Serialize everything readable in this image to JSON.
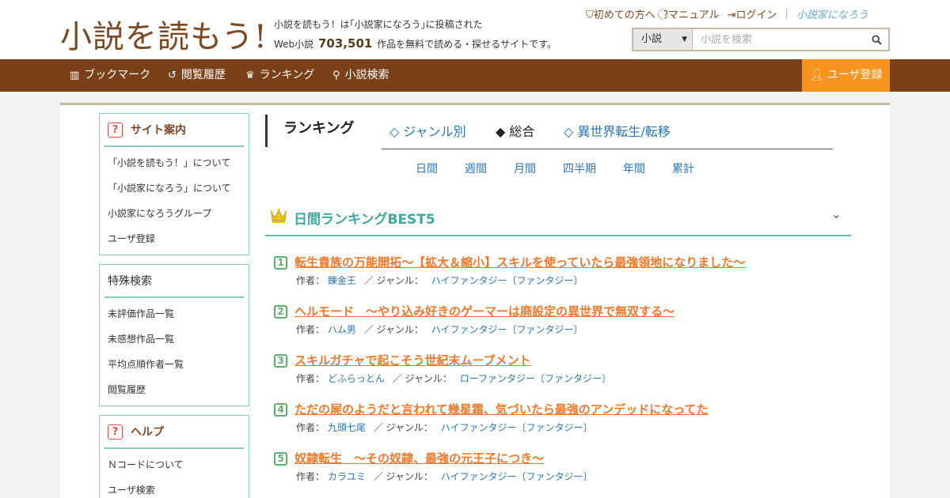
{
  "header": {
    "logo": "小説を読もう!",
    "tagline_line1": "小説を読もう！は｢小説家になろう｣に投稿された",
    "tagline_prefix": "Web小説",
    "novel_count": "703,501",
    "tagline_suffix": "作品を無料で読める・探せるサイトです。",
    "links": {
      "beginner": "初めての方へ",
      "manual": "マニュアル",
      "login": "ログイン",
      "brand": "小説家になろう"
    },
    "search": {
      "category": "小説",
      "placeholder": "小説を検索"
    }
  },
  "nav": {
    "bookmark": "ブックマーク",
    "history": "閲覧履歴",
    "ranking": "ランキング",
    "search": "小説検索",
    "register": "ユーザ登録"
  },
  "sidebar": {
    "site_guide": {
      "title": "サイト案内",
      "items": [
        "「小説を読もう！」について",
        "「小説家になろう」について",
        "小説家になろうグループ",
        "ユーザ登録"
      ]
    },
    "special_search": {
      "title": "特殊検索",
      "items": [
        "未評価作品一覧",
        "未感想作品一覧",
        "平均点順作者一覧",
        "閲覧履歴"
      ]
    },
    "help": {
      "title": "ヘルプ",
      "items": [
        "Ｎコードについて",
        "ユーザ検索"
      ]
    }
  },
  "ranking": {
    "title": "ランキング",
    "tabs": {
      "genre": "◇ ジャンル別",
      "overall": "◆ 総合",
      "isekai": "◇ 異世界転生/転移"
    },
    "periods": [
      "日間",
      "週間",
      "月間",
      "四半期",
      "年間",
      "累計"
    ],
    "best_title": "日間ランキングBEST5",
    "author_label": "作者：",
    "genre_label": "／ ジャンル：",
    "entries": [
      {
        "rank": "1",
        "title": "転生貴族の万能開拓～【拡大＆縮小】スキルを使っていたら最強領地になりました～",
        "author": "錬金王",
        "genre": "ハイファンタジー〔ファンタジー〕"
      },
      {
        "rank": "2",
        "title": "ヘルモード　～やり込み好きのゲーマーは廃設定の異世界で無双する～",
        "author": "ハム男",
        "genre": "ハイファンタジー〔ファンタジー〕"
      },
      {
        "rank": "3",
        "title": "スキルガチャで起こそう世紀末ムーブメント",
        "author": "どふらっとん",
        "genre": "ローファンタジー〔ファンタジー〕"
      },
      {
        "rank": "4",
        "title": "ただの屍のようだと言われて幾星霜、気づいたら最強のアンデッドになってた",
        "author": "九頭七尾",
        "genre": "ハイファンタジー〔ファンタジー〕"
      },
      {
        "rank": "5",
        "title": "奴隷転生　～その奴隷、最強の元王子につき～",
        "author": "カラユミ",
        "genre": "ハイファンタジー〔ファンタジー〕"
      }
    ]
  }
}
